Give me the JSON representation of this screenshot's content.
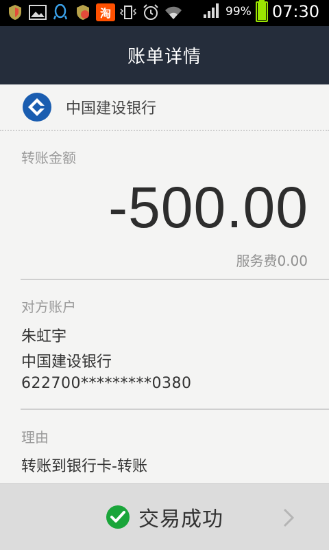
{
  "status_bar": {
    "icons": [
      "shield-icon",
      "gallery-icon",
      "qq-icon",
      "shield-icon",
      "taobao-icon",
      "vibrate-icon",
      "alarm-icon",
      "wifi-icon",
      "signal-icon"
    ],
    "taobao_glyph": "淘",
    "battery_percent": "99%",
    "battery_level": 0.99,
    "time": "07:30"
  },
  "header": {
    "title": "账单详情"
  },
  "bank": {
    "name": "中国建设银行",
    "logo_color": "#1a5db0"
  },
  "transfer": {
    "label": "转账金额",
    "amount": "-500.00",
    "fee": "服务费0.00"
  },
  "counterparty": {
    "label": "对方账户",
    "name": "朱虹宇",
    "bank": "中国建设银行",
    "account": "622700*********0380"
  },
  "reason": {
    "label": "理由",
    "text": "转账到银行卡-转账"
  },
  "result": {
    "text": "交易成功",
    "status_color": "#1aa53a"
  }
}
